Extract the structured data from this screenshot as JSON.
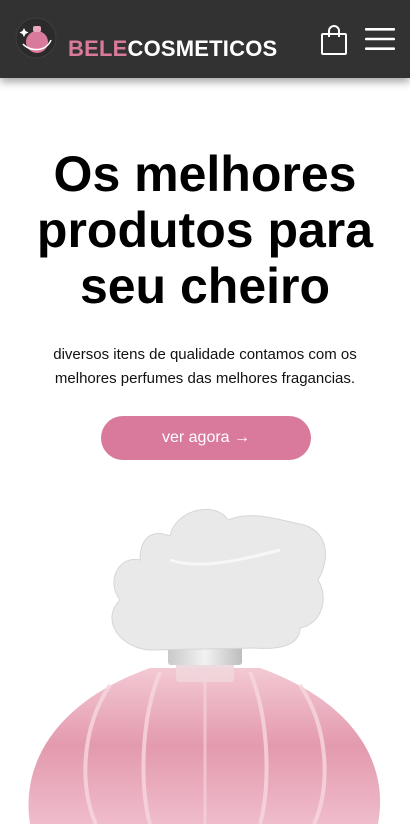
{
  "header": {
    "brand_accent": "BELE",
    "brand_rest": "COSMETICOS",
    "logo_icon": "perfume-logo-icon",
    "cart_icon": "shopping-bag-icon",
    "menu_icon": "hamburger-menu-icon"
  },
  "hero": {
    "title_line1": "Os melhores",
    "title_line2": "produtos para",
    "title_line3": "seu cheiro",
    "subtitle_line1": "diversos itens de qualidade contamos com os",
    "subtitle_line2": "melhores perfumes das melhores fragancias.",
    "cta_label": "ver agora →"
  },
  "product_image": {
    "icon": "perfume-bottle-image"
  },
  "colors": {
    "header_bg": "#323232",
    "accent": "#d97a9c",
    "text": "#000000"
  }
}
